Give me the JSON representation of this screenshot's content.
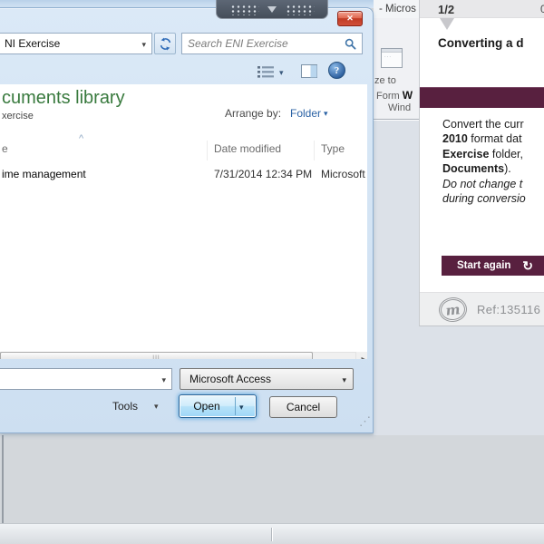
{
  "colors": {
    "accent_purple": "#58203f",
    "library_green": "#397a3e",
    "link_blue": "#2c63a5",
    "close_red": "#c13b24"
  },
  "icons": {
    "close": "✕",
    "caret_down": "▾",
    "sort_asc": "^",
    "scroll_grip": "|||",
    "scroll_arrow_right": "▸",
    "resize_grip": "⋰",
    "help": "?",
    "restart": "↻",
    "ribbon_form_dots": "∙∙∙"
  },
  "open_dialog": {
    "address_value": "NI Exercise",
    "search_placeholder": "Search ENI Exercise",
    "library_title": "cuments library",
    "library_subtitle": "xercise",
    "arrange_by_label": "Arrange by:",
    "arrange_by_value": "Folder",
    "list": {
      "columns": [
        "e",
        "Date modified",
        "Type"
      ],
      "rows": [
        [
          "ime management",
          "7/31/2014 12:34 PM",
          "Microsoft"
        ]
      ]
    },
    "file_name_value": "",
    "file_type_value": "Microsoft Access",
    "tools_label": "Tools",
    "open_label": "Open",
    "cancel_label": "Cancel"
  },
  "access_window": {
    "title_fragment": "- Micros",
    "ribbon_label_1": "ze to",
    "ribbon_label_2_pre": "Form ",
    "ribbon_label_2_bold": "W",
    "ribbon_label_3": "Wind"
  },
  "tutor_panel": {
    "pager": "1/2",
    "corner_fragment": "0",
    "heading": "Converting a d",
    "body_lines": [
      [
        {
          "t": "Convert the curr"
        }
      ],
      [
        {
          "t": "2010",
          "b": true
        },
        {
          "t": " format dat"
        }
      ],
      [
        {
          "t": "Exercise",
          "b": true
        },
        {
          "t": " folder, "
        }
      ],
      [
        {
          "t": "Documents",
          "b": true
        },
        {
          "t": ")."
        }
      ],
      [
        {
          "t": "Do not change t",
          "i": true
        }
      ],
      [
        {
          "t": "during conversio",
          "i": true
        }
      ]
    ],
    "start_again_label": "Start again",
    "ref_label": "Ref:135116",
    "logo_letter": "m"
  }
}
